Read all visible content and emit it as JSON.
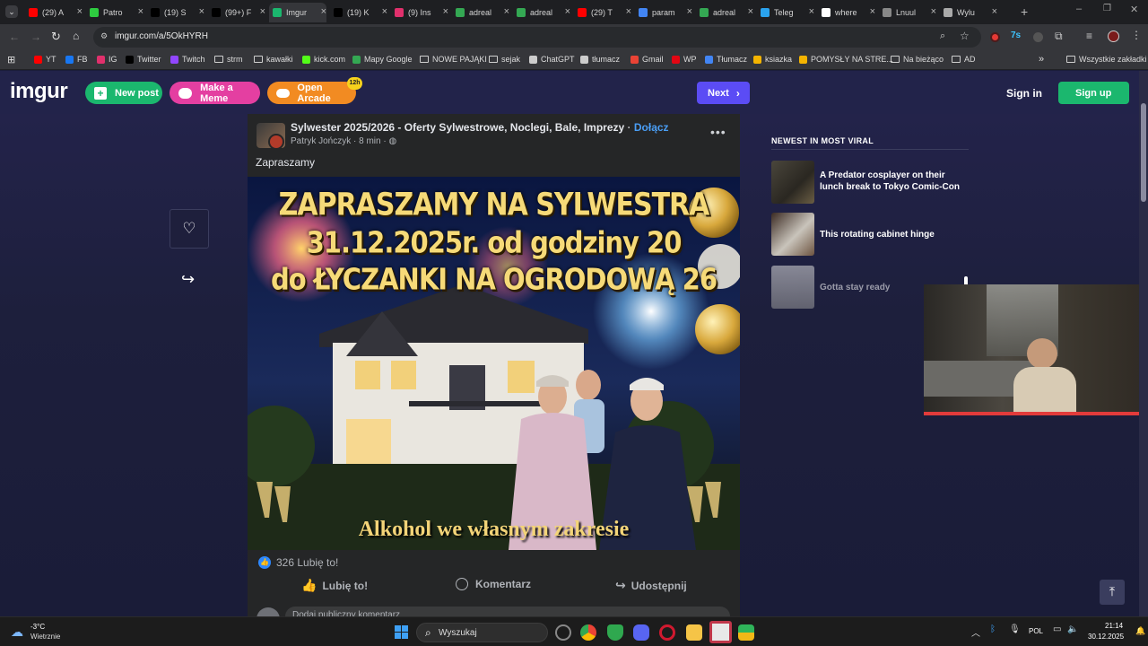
{
  "browser": {
    "tabs": [
      {
        "title": "(29) A",
        "color": "#ff0000"
      },
      {
        "title": "Patro",
        "color": "#2ecc40"
      },
      {
        "title": "(19) S",
        "color": "#000000"
      },
      {
        "title": "(99+) F",
        "color": "#000000"
      },
      {
        "title": "Imgur",
        "color": "#1bb76e"
      },
      {
        "title": "(19) K",
        "color": "#000000"
      },
      {
        "title": "(9) Ins",
        "color": "#e1306c"
      },
      {
        "title": "adreal",
        "color": "#34a853"
      },
      {
        "title": "adreal",
        "color": "#34a853"
      },
      {
        "title": "(29) T",
        "color": "#ff0000"
      },
      {
        "title": "param",
        "color": "#4285f4"
      },
      {
        "title": "adreal",
        "color": "#34a853"
      },
      {
        "title": "Teleg",
        "color": "#2aa3ef"
      },
      {
        "title": "where",
        "color": "#ffffff"
      },
      {
        "title": "Lnuul",
        "color": "#888888"
      },
      {
        "title": "Wylu",
        "color": "#aaaaaa"
      }
    ],
    "url": "imgur.com/a/5OkHYRH",
    "bookmarks": [
      {
        "label": "YT",
        "color": "#ff0000"
      },
      {
        "label": "FB",
        "color": "#1877f2"
      },
      {
        "label": "IG",
        "color": "#e1306c"
      },
      {
        "label": "Twitter",
        "color": "#000000"
      },
      {
        "label": "Twitch",
        "color": "#9146ff"
      },
      {
        "label": "strm",
        "folder": true
      },
      {
        "label": "kawałki",
        "folder": true
      },
      {
        "label": "kick.com",
        "color": "#53fc18"
      },
      {
        "label": "Mapy Google",
        "color": "#34a853"
      },
      {
        "label": "NOWE PAJĄKI",
        "folder": true
      },
      {
        "label": "sejak",
        "folder": true
      },
      {
        "label": "ChatGPT",
        "color": "#cccccc"
      },
      {
        "label": "tłumacz",
        "color": "#cccccc"
      },
      {
        "label": "Gmail",
        "color": "#ea4335"
      },
      {
        "label": "WP",
        "color": "#e30613"
      },
      {
        "label": "Tłumacz",
        "color": "#4285f4"
      },
      {
        "label": "ksiazka",
        "color": "#f4b400"
      },
      {
        "label": "POMYSŁY NA STRE...",
        "color": "#f4b400"
      },
      {
        "label": "Na bieżąco",
        "folder": true
      },
      {
        "label": "AD",
        "folder": true
      }
    ],
    "all_bookmarks": "Wszystkie zakładki"
  },
  "imgur": {
    "logo": "imgur",
    "new_post": "New post",
    "make_meme": "Make a Meme",
    "open_arcade": "Open Arcade",
    "arcade_badge": "12h",
    "next": "Next",
    "sign_in": "Sign in",
    "sign_up": "Sign up",
    "colors": {
      "new_post": "#1bb76e",
      "meme": "#e43fa1",
      "arcade": "#f28b22",
      "next": "#5b4cf5",
      "signup": "#1bb76e"
    }
  },
  "post": {
    "group": "Sylwester 2025/2026 - Oferty Sylwestrowe, Noclegi, Bale, Imprezy",
    "join": "Dołącz",
    "author": "Patryk Jończyk",
    "time": "8 min",
    "caption": "Zapraszamy",
    "poster_line1": "ZAPRASZAMY NA SYLWESTRA",
    "poster_line2": "31.12.2025r. od godziny 20",
    "poster_line3": "do ŁYCZANKI NA OGRODOWĄ 26",
    "poster_footer": "Alkohol we własnym zakresie",
    "likes": "326 Lubię to!",
    "like_action": "Lubię to!",
    "comment_action": "Komentarz",
    "share_action": "Udostępnij",
    "comment_placeholder": "Dodaj publiczny komentarz"
  },
  "sidebar": {
    "heading": "NEWEST IN MOST VIRAL",
    "items": [
      {
        "title": "A Predator cosplayer on their lunch break to Tokyo Comic-Con"
      },
      {
        "title": "This rotating cabinet hinge"
      },
      {
        "title": "Gotta stay ready"
      }
    ]
  },
  "taskbar": {
    "temp": "-3°C",
    "weather": "Wietrznie",
    "search": "Wyszukaj",
    "lang": "POL",
    "time": "21:14",
    "date": "30.12.2025"
  }
}
